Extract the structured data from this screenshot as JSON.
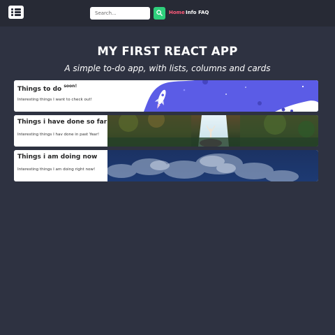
{
  "navbar": {
    "logo_icon": "list-icon",
    "search": {
      "placeholder": "Search...",
      "value": ""
    },
    "search_button_icon": "search-icon",
    "links": [
      {
        "label": "Home",
        "active": true
      },
      {
        "label": "Info",
        "active": false
      },
      {
        "label": "FAQ",
        "active": false
      }
    ],
    "active_color": "#ff5a7a",
    "accent_color": "#2fcf7c"
  },
  "header": {
    "title": "MY FIRST REACT APP",
    "subtitle": "A simple to-do app, with lists, columns and cards"
  },
  "cards": [
    {
      "title": "Things to do",
      "badge": "soon!",
      "text": "Interesting things I want to check out!",
      "image": "rocket-illustration"
    },
    {
      "title": "Things i have done so far",
      "text": "Interesting things I hav done in past Year!",
      "image": "waterfall-photo"
    },
    {
      "title": "Things i am doing now",
      "text": "Interesting things I am doing right now!",
      "image": "clouds-photo"
    }
  ],
  "colors": {
    "background": "#2e3241",
    "navbar": "#272a35",
    "rocket_purple": "#5b5ce6"
  }
}
